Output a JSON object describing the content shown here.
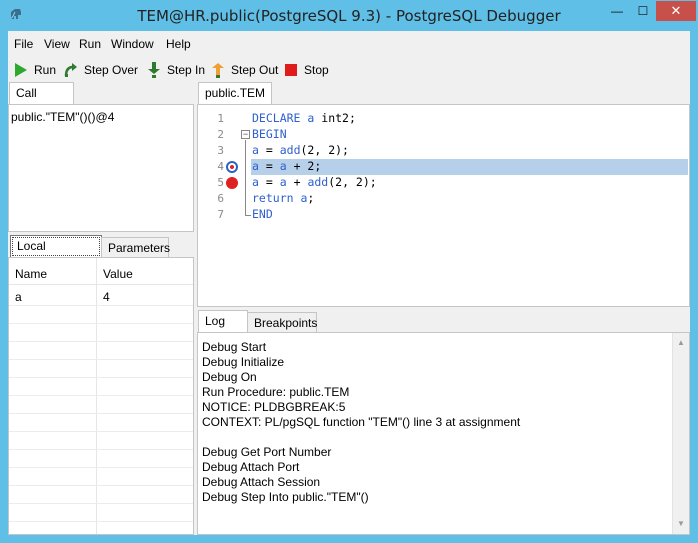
{
  "window": {
    "title": "TEM@HR.public(PostgreSQL 9.3) - PostgreSQL Debugger",
    "controls": {
      "minimize": "—",
      "maximize": "☐",
      "close": "✕"
    }
  },
  "menu": [
    "File",
    "View",
    "Run",
    "Window",
    "Help"
  ],
  "toolbar": {
    "run": "Run",
    "step_over": "Step Over",
    "step_in": "Step In",
    "step_out": "Step Out",
    "stop": "Stop"
  },
  "callstack": {
    "tab": "Call Stack",
    "entries": [
      "public.\"TEM\"()()@4"
    ]
  },
  "variables": {
    "tabs": [
      "Local Variables",
      "Parameters"
    ],
    "columns": [
      "Name",
      "Value"
    ],
    "rows": [
      {
        "name": "a",
        "value": "4"
      }
    ]
  },
  "editor": {
    "tab": "public.TEM",
    "line_numbers": [
      "1",
      "2",
      "3",
      "4",
      "5",
      "6",
      "7"
    ],
    "current_line": 4,
    "breakpoint_lines": [
      4,
      5
    ]
  },
  "log": {
    "tabs": [
      "Log",
      "Breakpoints"
    ],
    "lines": [
      "Debug Start",
      "Debug Initialize",
      "Debug On",
      "Run Procedure: public.TEM",
      "NOTICE:  PLDBGBREAK:5",
      "CONTEXT:  PL/pgSQL function \"TEM\"() line 3 at assignment",
      "",
      "Debug Get Port Number",
      "Debug Attach Port",
      "Debug Attach Session",
      "Debug Step Into public.\"TEM\"()"
    ]
  },
  "colors": {
    "titlebar": "#5fbfe6",
    "close_button": "#c7504b",
    "keyword": "#2f5fd0",
    "current_line_highlight": "#b7d0e9",
    "breakpoint": "#e02121",
    "run_icon": "#2fa82f",
    "stop_icon": "#e01b1b",
    "step_out_icon": "#f0a030"
  }
}
